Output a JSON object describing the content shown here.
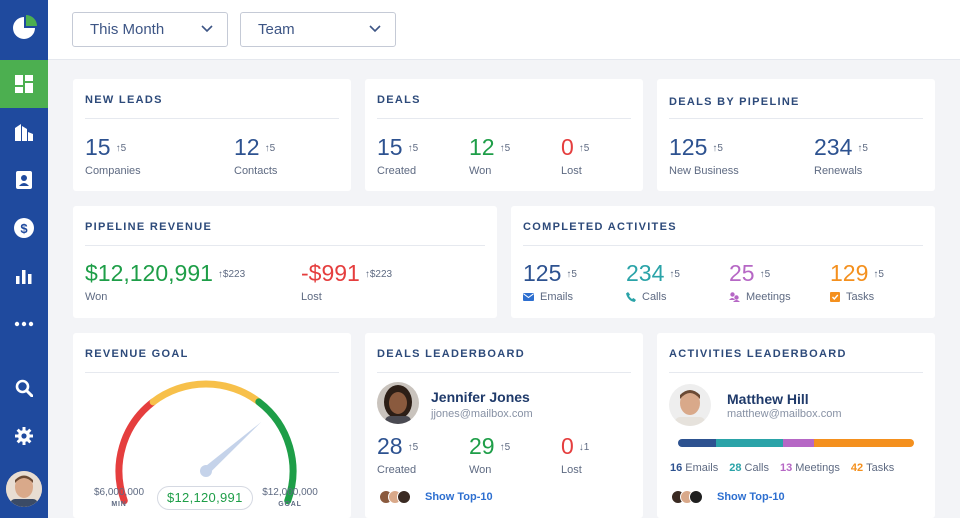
{
  "filters": {
    "period": "This Month",
    "group": "Team"
  },
  "sidebar": {
    "items": [
      "logo-icon",
      "dashboard-icon",
      "buildings-icon",
      "contacts-icon",
      "dollar-icon",
      "bar-chart-icon",
      "more-icon",
      "search-icon",
      "gear-icon"
    ]
  },
  "colors": {
    "sidebar": "#1f4a9e",
    "active": "#4caf50",
    "green": "#1e9e48",
    "red": "#e53e3e",
    "blue": "#2d5290",
    "teal": "#2aa3a8",
    "purple": "#b667c5",
    "orange": "#f4901e"
  },
  "new_leads": {
    "title": "NEW LEADS",
    "stats": [
      {
        "value": "15",
        "delta": "↑5",
        "label": "Companies"
      },
      {
        "value": "12",
        "delta": "↑5",
        "label": "Contacts"
      }
    ]
  },
  "deals": {
    "title": "DEALS",
    "stats": [
      {
        "value": "15",
        "delta": "↑5",
        "label": "Created"
      },
      {
        "value": "12",
        "delta": "↑5",
        "label": "Won"
      },
      {
        "value": "0",
        "delta": "↑5",
        "label": "Lost"
      }
    ]
  },
  "deals_by_pipeline": {
    "title": "DEALS BY PIPELINE",
    "stats": [
      {
        "value": "125",
        "delta": "↑5",
        "label": "New Business"
      },
      {
        "value": "234",
        "delta": "↑5",
        "label": "Renewals"
      }
    ]
  },
  "pipeline_revenue": {
    "title": "PIPELINE REVENUE",
    "stats": [
      {
        "value": "$12,120,991",
        "delta": "↑$223",
        "label": "Won"
      },
      {
        "value": "-$991",
        "delta": "↑$223",
        "label": "Lost"
      }
    ]
  },
  "completed_activities": {
    "title": "COMPLETED ACTIVITES",
    "stats": [
      {
        "value": "125",
        "delta": "↑5",
        "label": "Emails",
        "icon": "email-icon"
      },
      {
        "value": "234",
        "delta": "↑5",
        "label": "Calls",
        "icon": "phone-icon"
      },
      {
        "value": "25",
        "delta": "↑5",
        "label": "Meetings",
        "icon": "meeting-icon"
      },
      {
        "value": "129",
        "delta": "↑5",
        "label": "Tasks",
        "icon": "task-icon"
      }
    ]
  },
  "revenue_goal": {
    "title": "REVENUE GOAL",
    "min_value": "$6,000,000",
    "min_label": "MIN",
    "max_value": "$12,000,000",
    "max_label": "GOAL",
    "current": "$12,120,991",
    "level": 0.72
  },
  "deals_leaderboard": {
    "title": "DEALS LEADERBOARD",
    "name": "Jennifer Jones",
    "email": "jjones@mailbox.com",
    "stats": [
      {
        "value": "28",
        "delta": "↑5",
        "label": "Created"
      },
      {
        "value": "29",
        "delta": "↑5",
        "label": "Won"
      },
      {
        "value": "0",
        "delta": "↓1",
        "label": "Lost"
      }
    ],
    "link": "Show Top-10"
  },
  "activities_leaderboard": {
    "title": "ACTIVITIES LEADERBOARD",
    "name": "Matthew Hill",
    "email": "matthew@mailbox.com",
    "counts": [
      {
        "value": "16",
        "label": "Emails",
        "color": "#2d5290"
      },
      {
        "value": "28",
        "label": "Calls",
        "color": "#2aa3a8"
      },
      {
        "value": "13",
        "label": "Meetings",
        "color": "#b667c5"
      },
      {
        "value": "42",
        "label": "Tasks",
        "color": "#f4901e"
      }
    ],
    "link": "Show Top-10"
  }
}
